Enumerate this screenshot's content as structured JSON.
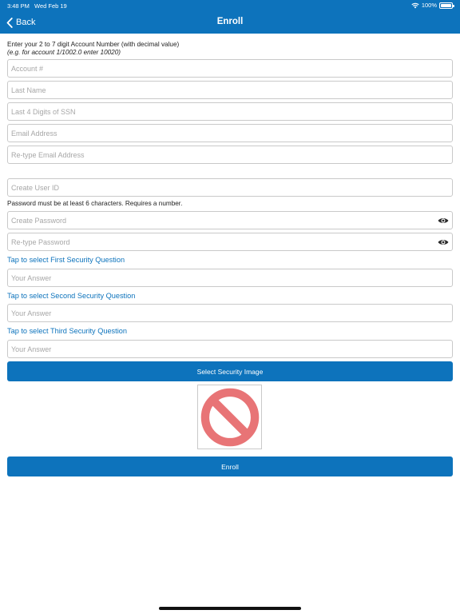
{
  "status": {
    "time": "3:48 PM",
    "date": "Wed Feb 19",
    "battery": "100%"
  },
  "nav": {
    "back_label": "Back",
    "title": "Enroll"
  },
  "instructions": {
    "line1": "Enter your 2 to 7 digit Account Number (with decimal value)",
    "line2": "(e.g. for account 1/1002.0 enter 10020)"
  },
  "fields": {
    "account": {
      "placeholder": "Account #"
    },
    "last_name": {
      "placeholder": "Last Name"
    },
    "ssn": {
      "placeholder": "Last 4 Digits of SSN"
    },
    "email": {
      "placeholder": "Email Address"
    },
    "email_confirm": {
      "placeholder": "Re-type Email Address"
    },
    "user_id": {
      "placeholder": "Create User ID"
    },
    "password": {
      "placeholder": "Create Password"
    },
    "password_confirm": {
      "placeholder": "Re-type Password"
    },
    "answer1": {
      "placeholder": "Your Answer"
    },
    "answer2": {
      "placeholder": "Your Answer"
    },
    "answer3": {
      "placeholder": "Your Answer"
    }
  },
  "password_hint": "Password must be at least 6 characters. Requires a number.",
  "security_questions": {
    "first": "Tap to select First Security Question",
    "second": "Tap to select Second Security Question",
    "third": "Tap to select Third Security Question"
  },
  "buttons": {
    "select_image": "Select Security Image",
    "enroll": "Enroll"
  },
  "colors": {
    "brand": "#0d73bc",
    "no_image_red": "#e87476"
  },
  "icons": {
    "back": "chevron-left-icon",
    "eye": "eye-icon",
    "no_image": "no-symbol-icon",
    "wifi": "wifi-icon",
    "battery": "battery-icon"
  }
}
